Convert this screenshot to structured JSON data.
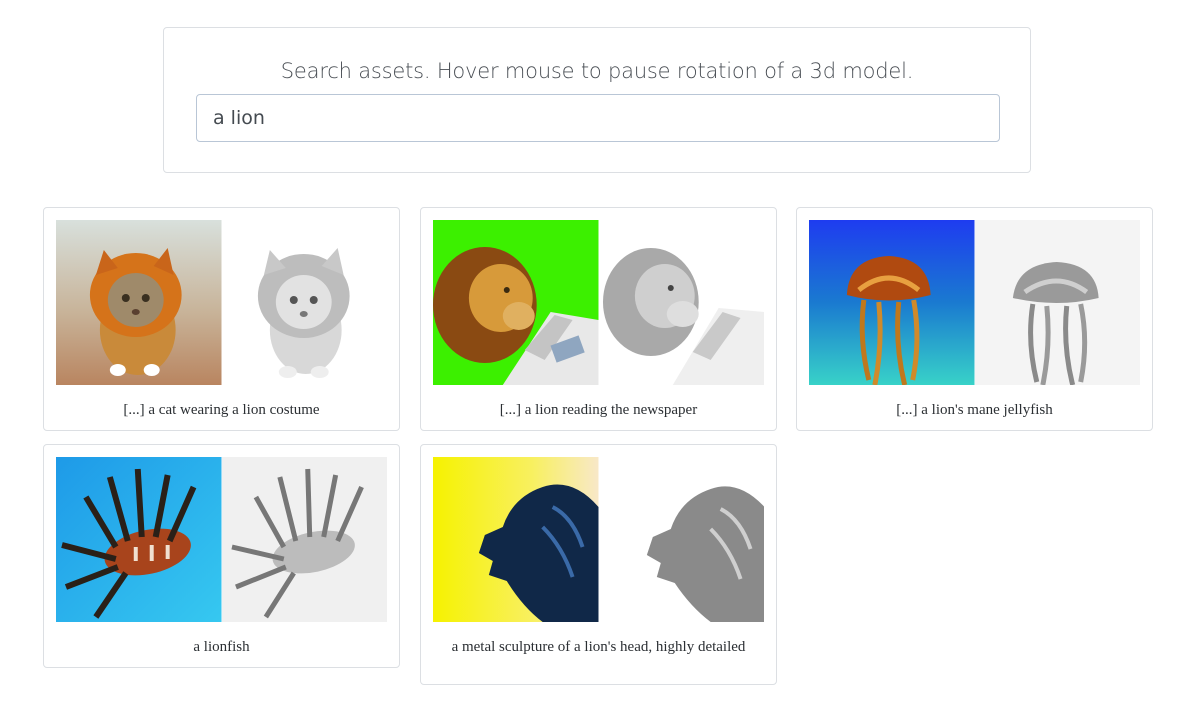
{
  "search": {
    "title": "Search assets. Hover mouse to pause rotation of a 3d model.",
    "value": "a lion"
  },
  "results": [
    {
      "caption": "[...] a cat wearing a lion costume",
      "color_bg": "#c9a27a",
      "subject": "cat-in-lion-costume"
    },
    {
      "caption": "[...] a lion reading the newspaper",
      "color_bg": "#3cf000",
      "subject": "lion-reading-newspaper"
    },
    {
      "caption": "[...] a lion's mane jellyfish",
      "color_bg": "#1e5bd8",
      "subject": "jellyfish"
    },
    {
      "caption": "a lionfish",
      "color_bg": "#2aa0e8",
      "subject": "lionfish"
    },
    {
      "caption": "a metal sculpture of a lion's head, highly detailed",
      "color_bg": "#f6f200",
      "subject": "lion-head-sculpture"
    }
  ]
}
